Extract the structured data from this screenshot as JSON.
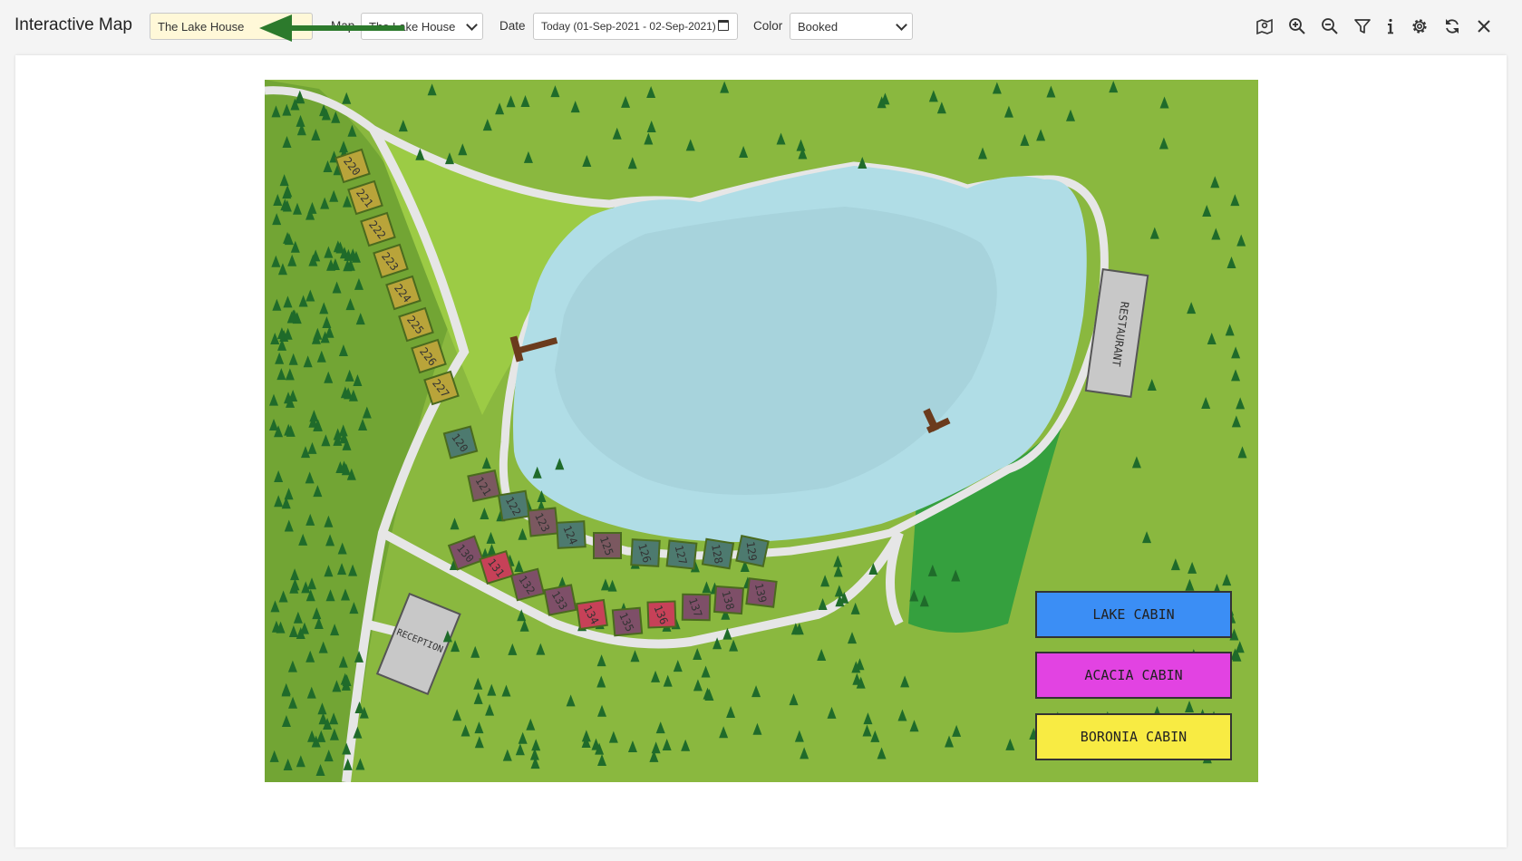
{
  "header": {
    "title": "Interactive Map",
    "property_value": "The Lake House",
    "map_label": "Map",
    "map_value": "The Lake House",
    "date_label": "Date",
    "date_value": "Today (01-Sep-2021 - 02-Sep-2021)",
    "color_label": "Color",
    "color_value": "Booked"
  },
  "toolbar_icons": [
    "map-icon",
    "zoom-in-icon",
    "zoom-out-icon",
    "filter-icon",
    "info-icon",
    "settings-icon",
    "refresh-icon",
    "close-icon"
  ],
  "map": {
    "restaurant_label": "RESTAURANT",
    "reception_label": "RECEPTION",
    "legend": [
      {
        "label": "LAKE CABIN",
        "color": "#3b8ef5"
      },
      {
        "label": "ACACIA CABIN",
        "color": "#e243e2"
      },
      {
        "label": "BORONIA CABIN",
        "color": "#f8eb43"
      }
    ],
    "cabins_boronia": [
      "220",
      "221",
      "222",
      "223",
      "224",
      "225",
      "226",
      "227"
    ],
    "cabins_upper": [
      "120",
      "121",
      "122",
      "123",
      "124",
      "125",
      "126",
      "127",
      "128",
      "129"
    ],
    "cabins_lower": [
      "130",
      "131",
      "132",
      "133",
      "134",
      "135",
      "136",
      "137",
      "138",
      "139"
    ]
  },
  "colors": {
    "accent_arrow": "#2c7a2c",
    "grass": "#8ab83f",
    "forest": "#72a534",
    "lake": "#b0dde6",
    "path": "#e6e6e6"
  }
}
